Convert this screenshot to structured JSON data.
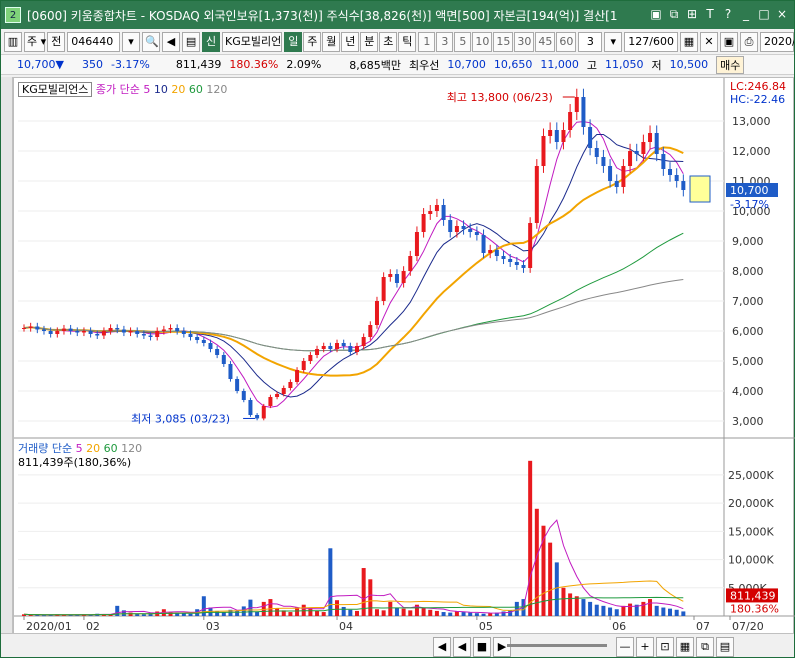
{
  "title": {
    "app_num": "2",
    "text": "[0600] 키움종합차트 - KOSDAQ 외국인보유[1,373(천)] 주식수[38,826(천)] 액면[500] 자본금[194(억)] 결산[1"
  },
  "titlebar_icons": [
    "grid-icon",
    "copy-icon",
    "link-icon",
    "help-icon",
    "settings-icon",
    "minimize-icon",
    "restore-icon",
    "close-icon"
  ],
  "titlebar_icon_glyphs": [
    "▣",
    "⧉",
    "⊞",
    "T",
    "?",
    "_",
    "□",
    "×"
  ],
  "toolbar": {
    "period_label": "주",
    "prev_label": "전",
    "code_value": "046440",
    "stock_badge": "신",
    "stock_name": "KG모빌리언",
    "periods": [
      "일",
      "주",
      "월",
      "년",
      "분",
      "초",
      "틱"
    ],
    "minute_options": [
      "1",
      "3",
      "5",
      "10",
      "15",
      "30",
      "45",
      "60"
    ],
    "count_value": "3",
    "range_value": "127/600",
    "date_value": "2020/"
  },
  "infobar": {
    "price": "10,700",
    "change": "350",
    "change_pct": "-3.17%",
    "volume": "811,439",
    "volume_pct": "180.36%",
    "turnover": "2.09%",
    "amount": "8,685백만",
    "best_ask_label": "최우선",
    "ask": "10,700",
    "bid": "10,650",
    "open": "11,000",
    "high_label": "고",
    "high": "11,050",
    "low_label": "저",
    "low": "10,500",
    "trade_btn": "매수"
  },
  "legend_price": {
    "name": "KG모빌리언스",
    "label": "종가 단순",
    "ma": [
      "5",
      "10",
      "20",
      "60",
      "120"
    ]
  },
  "legend_volume": {
    "label": "거래량 단순",
    "ma": [
      "5",
      "20",
      "60",
      "120"
    ],
    "current": "811,439주(180,36%)"
  },
  "annotations": {
    "high": "최고 13,800 (06/23)",
    "low": "최저 3,085 (03/23)",
    "lc": "LC:246.84",
    "hc": "HC:-22.46",
    "price_tag": "10,700",
    "pct_tag": "-3.17%",
    "vol_tag": "811,439",
    "vol_pct_tag": "180.36%"
  },
  "colors": {
    "up": "#e8191e",
    "down": "#1f5cc7",
    "ma5": "#c11bc1",
    "ma10": "#1b2a8c",
    "ma20": "#f2a400",
    "ma60": "#1f9a3e",
    "ma120": "#888888"
  },
  "chart_data": {
    "type": "candlestick",
    "x_axis_labels": [
      "2020/01",
      "02",
      "03",
      "04",
      "05",
      "06",
      "07",
      "07/20"
    ],
    "price_axis_ticks": [
      "13,000",
      "12,000",
      "11,000",
      "10,000",
      "9,000",
      "8,000",
      "7,000",
      "6,000",
      "5,000",
      "4,000",
      "3,000"
    ],
    "price_range": [
      2500,
      13900
    ],
    "volume_axis_ticks": [
      "25,000K",
      "20,000K",
      "15,000K",
      "10,000K",
      "5,000K"
    ],
    "volume_range_k": [
      0,
      28000
    ],
    "close_series": [
      6100,
      6150,
      6050,
      6000,
      5900,
      6000,
      6080,
      6000,
      5950,
      6000,
      5900,
      5850,
      6000,
      6100,
      6050,
      5950,
      6000,
      5900,
      5850,
      5800,
      6000,
      6050,
      6100,
      6000,
      5900,
      5800,
      5700,
      5600,
      5400,
      5200,
      4900,
      4400,
      4000,
      3700,
      3200,
      3085,
      3500,
      3800,
      3900,
      4100,
      4300,
      4700,
      5000,
      5200,
      5400,
      5500,
      5400,
      5600,
      5500,
      5300,
      5500,
      5800,
      6200,
      7000,
      7800,
      7900,
      7600,
      8000,
      8500,
      9300,
      9900,
      10000,
      10200,
      9700,
      9300,
      9500,
      9400,
      9300,
      9200,
      8600,
      8700,
      8500,
      8400,
      8300,
      8200,
      8100,
      9600,
      11500,
      12500,
      12700,
      12300,
      12700,
      13300,
      13800,
      12800,
      12100,
      11800,
      11500,
      11000,
      10800,
      11500,
      12000,
      11900,
      12300,
      12600,
      11900,
      11400,
      11200,
      11000,
      10700
    ],
    "volume_series_k": [
      300,
      200,
      250,
      150,
      200,
      300,
      180,
      200,
      250,
      300,
      200,
      400,
      300,
      200,
      1800,
      1000,
      600,
      400,
      300,
      500,
      800,
      1200,
      700,
      600,
      500,
      400,
      1200,
      3500,
      1500,
      900,
      700,
      1100,
      900,
      1700,
      2900,
      800,
      2500,
      3000,
      1400,
      1000,
      700,
      1500,
      2000,
      1400,
      900,
      700,
      12000,
      2800,
      1600,
      1100,
      900,
      8500,
      6500,
      1200,
      1000,
      2500,
      1500,
      1300,
      1000,
      2000,
      1400,
      1100,
      900,
      700,
      600,
      800,
      700,
      600,
      500,
      400,
      500,
      600,
      800,
      1000,
      2500,
      3000,
      27500,
      19000,
      16000,
      13000,
      9500,
      5000,
      4000,
      3500,
      3000,
      2500,
      2000,
      1800,
      1500,
      1200,
      1800,
      2200,
      2000,
      2500,
      3000,
      1800,
      1500,
      1300,
      1100,
      811
    ]
  }
}
